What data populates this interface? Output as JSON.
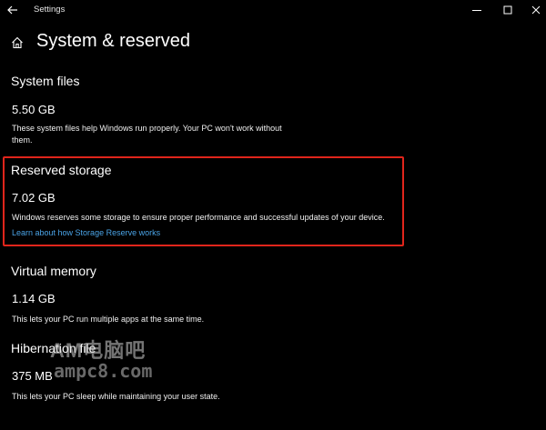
{
  "window": {
    "app_title": "Settings"
  },
  "header": {
    "page_title": "System & reserved"
  },
  "sections": [
    {
      "title": "System files",
      "size": "5.50 GB",
      "description": "These system files help Windows run properly. Your PC won't work without them."
    },
    {
      "title": "Reserved storage",
      "size": "7.02 GB",
      "description": "Windows reserves some storage to ensure proper performance and successful updates of your device.",
      "link": "Learn about how Storage Reserve works",
      "highlighted": true
    },
    {
      "title": "Virtual memory",
      "size": "1.14 GB",
      "description": "This lets your PC run multiple apps at the same time."
    },
    {
      "title": "Hibernation file",
      "size": "375 MB",
      "description": "This lets your PC sleep while maintaining your user state."
    }
  ],
  "watermark": {
    "line1": "AM电脑吧",
    "line2": "ampc8.com"
  },
  "colors": {
    "background": "#000000",
    "text": "#ffffff",
    "link": "#4aa3e6",
    "highlight_border": "#e0251b"
  },
  "icons": {
    "back": "back-arrow-icon",
    "home": "home-icon",
    "minimize": "minimize-icon",
    "maximize": "maximize-icon",
    "close": "close-icon"
  }
}
